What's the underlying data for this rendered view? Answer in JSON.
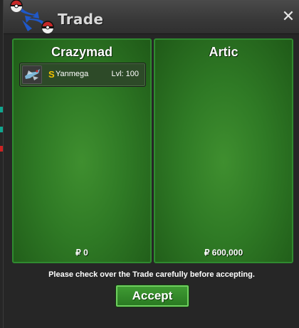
{
  "window": {
    "title": "Trade",
    "close_symbol": "✕"
  },
  "left_trader": {
    "name": "Crazymad",
    "money": "₽ 0",
    "items": [
      {
        "icon": "pokemon-sprite",
        "currency_symbol": "S",
        "pokemon": "Yanmega",
        "level": "Lvl: 100"
      }
    ]
  },
  "right_trader": {
    "name": "Artic",
    "money": "₽ 600,000",
    "items": []
  },
  "notice": "Please check over the Trade carefully before accepting.",
  "accept_label": "Accept",
  "colors": {
    "panel_green": "#2f7a25",
    "button_green": "#3f9b33",
    "coin_gold": "#f2c200"
  }
}
